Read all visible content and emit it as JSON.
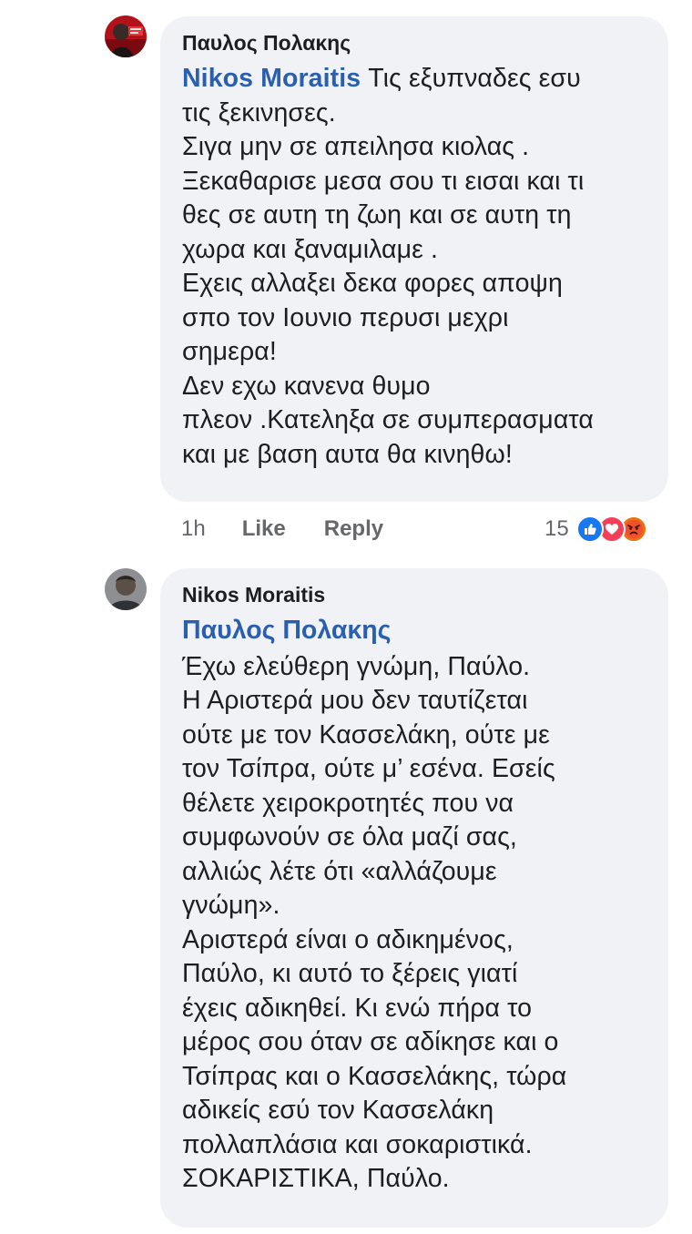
{
  "comments": [
    {
      "author": "Παυλος Πολακης",
      "mention": "Nikos Moraitis",
      "first_line_rest": " Τις εξυπναδες εσυ",
      "text": "τις ξεκινησες.\nΣιγα μην σε απειλησα κιολας .\nΞεκαθαρισε μεσα σου τι εισαι και τι\nθες σε αυτη τη ζωη  και σε αυτη τη\nχωρα και ξαναμιλαμε .\nΕχεις αλλαξει δεκα φορες αποψη\nσπο τον Ιουνιο περυσι μεχρι\nσημερα!\nΔεν εχω κανενα θυμο\nπλεον .Κατεληξα σε συμπερασματα\nκαι με βαση αυτα θα κινηθω!",
      "time": "1h",
      "like_label": "Like",
      "reply_label": "Reply",
      "reaction_count": "15",
      "reactions": [
        "like",
        "love",
        "angry"
      ]
    },
    {
      "author": "Nikos Moraitis",
      "mention": "Παυλος Πολακης",
      "text": "Έχω ελεύθερη γνώμη, Παύλο.\nΗ Αριστερά μου δεν ταυτίζεται\nούτε με τον Κασσελάκη, ούτε με\nτον Τσίπρα, ούτε μ’ εσένα. Εσείς\nθέλετε χειροκροτητές που να\nσυμφωνούν σε όλα μαζί σας,\nαλλιώς λέτε ότι «αλλάζουμε\nγνώμη».\nΑριστερά είναι ο αδικημένος,\nΠαύλο, κι αυτό το ξέρεις γιατί\nέχεις αδικηθεί. Κι ενώ πήρα το\nμέρος σου όταν σε αδίκησε και ο\nΤσίπρας και ο Κασσελάκης, τώρα\nαδικείς εσύ τον Κασσελάκη\nπολλαπλάσια και σοκαριστικά.\nΣΟΚΑΡΙΣΤΙΚΑ, Παύλο."
    }
  ],
  "colors": {
    "bubble": "#f0f2f5",
    "mention": "#2a5fb0",
    "meta": "#65676b",
    "like": "#1877f2",
    "love": "#f33e58",
    "angry": "#e9710f"
  }
}
